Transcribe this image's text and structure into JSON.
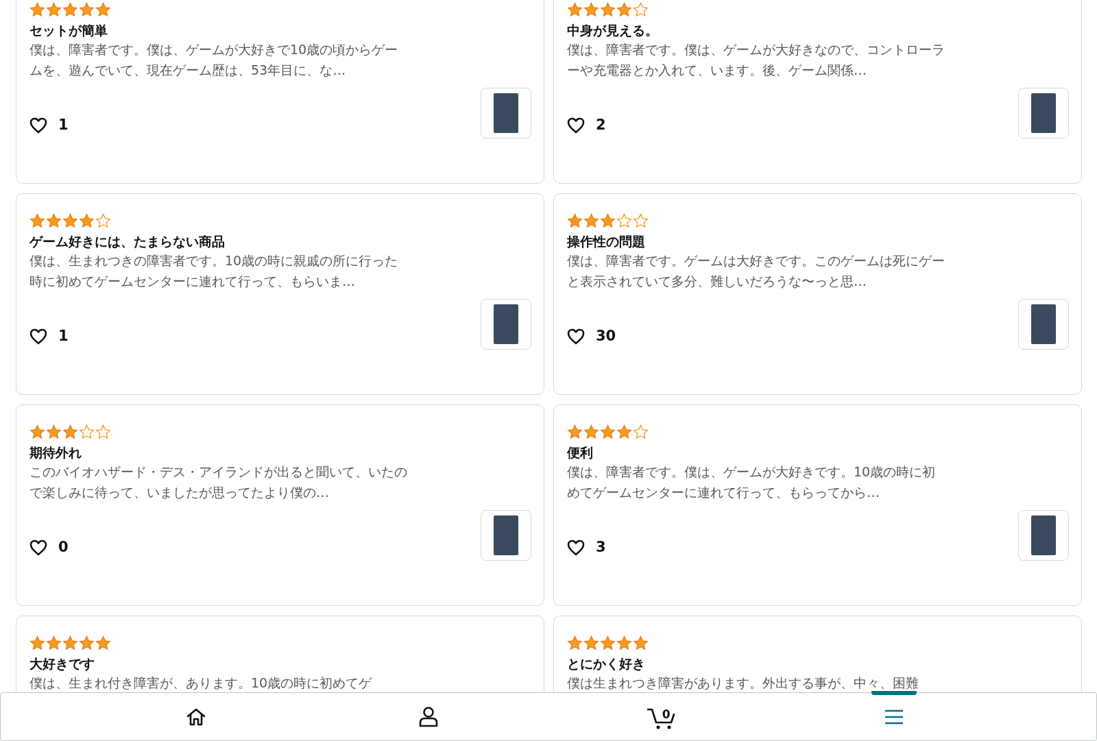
{
  "reviews": [
    {
      "stars": 5,
      "title": "セットが簡単",
      "body": "僕は、障害者です。僕は、ゲームが大好きで10歳の頃からゲームを、遊んでいて、現在ゲーム歴は、53年目に、な…",
      "likes": "1"
    },
    {
      "stars": 4,
      "title": "中身が見える。",
      "body": "僕は、障害者です。僕は、ゲームが大好きなので、コントローラーや充電器とか入れて、います。後、ゲーム関係…",
      "likes": "2"
    },
    {
      "stars": 4,
      "title": "ゲーム好きには、たまらない商品",
      "body": "僕は、生まれつきの障害者です。10歳の時に親戚の所に行った時に初めてゲームセンターに連れて行って、もらいま…",
      "likes": "1"
    },
    {
      "stars": 3,
      "title": "操作性の問題",
      "body": "僕は、障害者です。ゲームは大好きです。このゲームは死にゲーと表示されていて多分、難しいだろうな〜っと思…",
      "likes": "30"
    },
    {
      "stars": 3,
      "title": "期待外れ",
      "body": "このバイオハザード・デス・アイランドが出ると聞いて、いたので楽しみに待って、いましたが思ってたより僕の…",
      "likes": "0"
    },
    {
      "stars": 4,
      "title": "便利",
      "body": "僕は、障害者です。僕は、ゲームが大好きです。10歳の時に初めてゲームセンターに連れて行って、もらってから…",
      "likes": "3"
    },
    {
      "stars": 5,
      "title": "大好きです",
      "body": "僕は、生まれ付き障害が、あります。10歳の時に初めてゲ"
    },
    {
      "stars": 5,
      "title": "とにかく好き",
      "body": "僕は生まれつき障害があります。外出する事が、中々、困難"
    }
  ],
  "nav": [
    {
      "kind": "home",
      "selected": false
    },
    {
      "kind": "account",
      "selected": false
    },
    {
      "kind": "cart",
      "selected": false,
      "count": "0"
    },
    {
      "kind": "menu",
      "selected": true
    }
  ]
}
